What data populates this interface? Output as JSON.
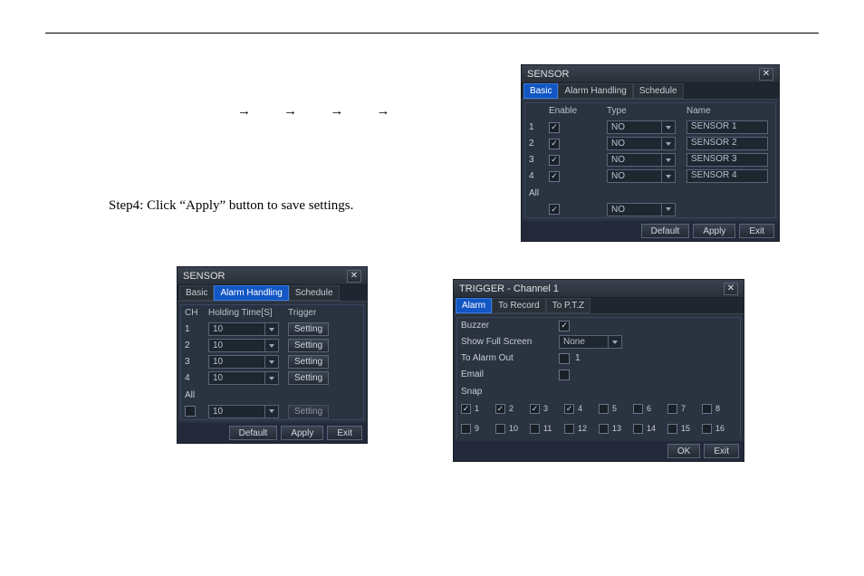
{
  "arrows": [
    "→",
    "→",
    "→",
    "→"
  ],
  "step_text": "Step4: Click “Apply” button to save settings.",
  "sensor1": {
    "title": "SENSOR",
    "tabs": [
      "Basic",
      "Alarm Handling",
      "Schedule"
    ],
    "active_tab": 0,
    "headers": {
      "enable": "Enable",
      "type": "Type",
      "name": "Name"
    },
    "rows": [
      {
        "ch": "1",
        "enable": true,
        "type": "NO",
        "name": "SENSOR 1"
      },
      {
        "ch": "2",
        "enable": true,
        "type": "NO",
        "name": "SENSOR 2"
      },
      {
        "ch": "3",
        "enable": true,
        "type": "NO",
        "name": "SENSOR 3"
      },
      {
        "ch": "4",
        "enable": true,
        "type": "NO",
        "name": "SENSOR 4"
      }
    ],
    "all_label": "All",
    "all_enable": true,
    "all_type": "NO",
    "buttons": {
      "default": "Default",
      "apply": "Apply",
      "exit": "Exit"
    }
  },
  "sensor2": {
    "title": "SENSOR",
    "tabs": [
      "Basic",
      "Alarm Handling",
      "Schedule"
    ],
    "active_tab": 1,
    "headers": {
      "ch": "CH",
      "holding": "Holding Time[S]",
      "trigger": "Trigger"
    },
    "rows": [
      {
        "ch": "1",
        "holding": "10",
        "trigger": "Setting"
      },
      {
        "ch": "2",
        "holding": "10",
        "trigger": "Setting"
      },
      {
        "ch": "3",
        "holding": "10",
        "trigger": "Setting"
      },
      {
        "ch": "4",
        "holding": "10",
        "trigger": "Setting"
      }
    ],
    "all_label": "All",
    "all_holding": "10",
    "all_trigger": "Setting",
    "buttons": {
      "default": "Default",
      "apply": "Apply",
      "exit": "Exit"
    }
  },
  "trigger": {
    "title": "TRIGGER - Channel 1",
    "tabs": [
      "Alarm",
      "To Record",
      "To P.T.Z"
    ],
    "active_tab": 0,
    "labels": {
      "buzzer": "Buzzer",
      "show_full": "Show Full Screen",
      "to_alarm_out": "To Alarm Out",
      "email": "Email",
      "snap": "Snap"
    },
    "buzzer": true,
    "full_screen_value": "None",
    "alarm_out_checked": false,
    "alarm_out_label": "1",
    "email": false,
    "snap_row1": [
      {
        "n": "1",
        "v": true
      },
      {
        "n": "2",
        "v": true
      },
      {
        "n": "3",
        "v": true
      },
      {
        "n": "4",
        "v": true
      },
      {
        "n": "5",
        "v": false
      },
      {
        "n": "6",
        "v": false
      },
      {
        "n": "7",
        "v": false
      },
      {
        "n": "8",
        "v": false
      }
    ],
    "snap_row2": [
      {
        "n": "9",
        "v": false
      },
      {
        "n": "10",
        "v": false
      },
      {
        "n": "11",
        "v": false
      },
      {
        "n": "12",
        "v": false
      },
      {
        "n": "13",
        "v": false
      },
      {
        "n": "14",
        "v": false
      },
      {
        "n": "15",
        "v": false
      },
      {
        "n": "16",
        "v": false
      }
    ],
    "buttons": {
      "ok": "OK",
      "exit": "Exit"
    }
  }
}
